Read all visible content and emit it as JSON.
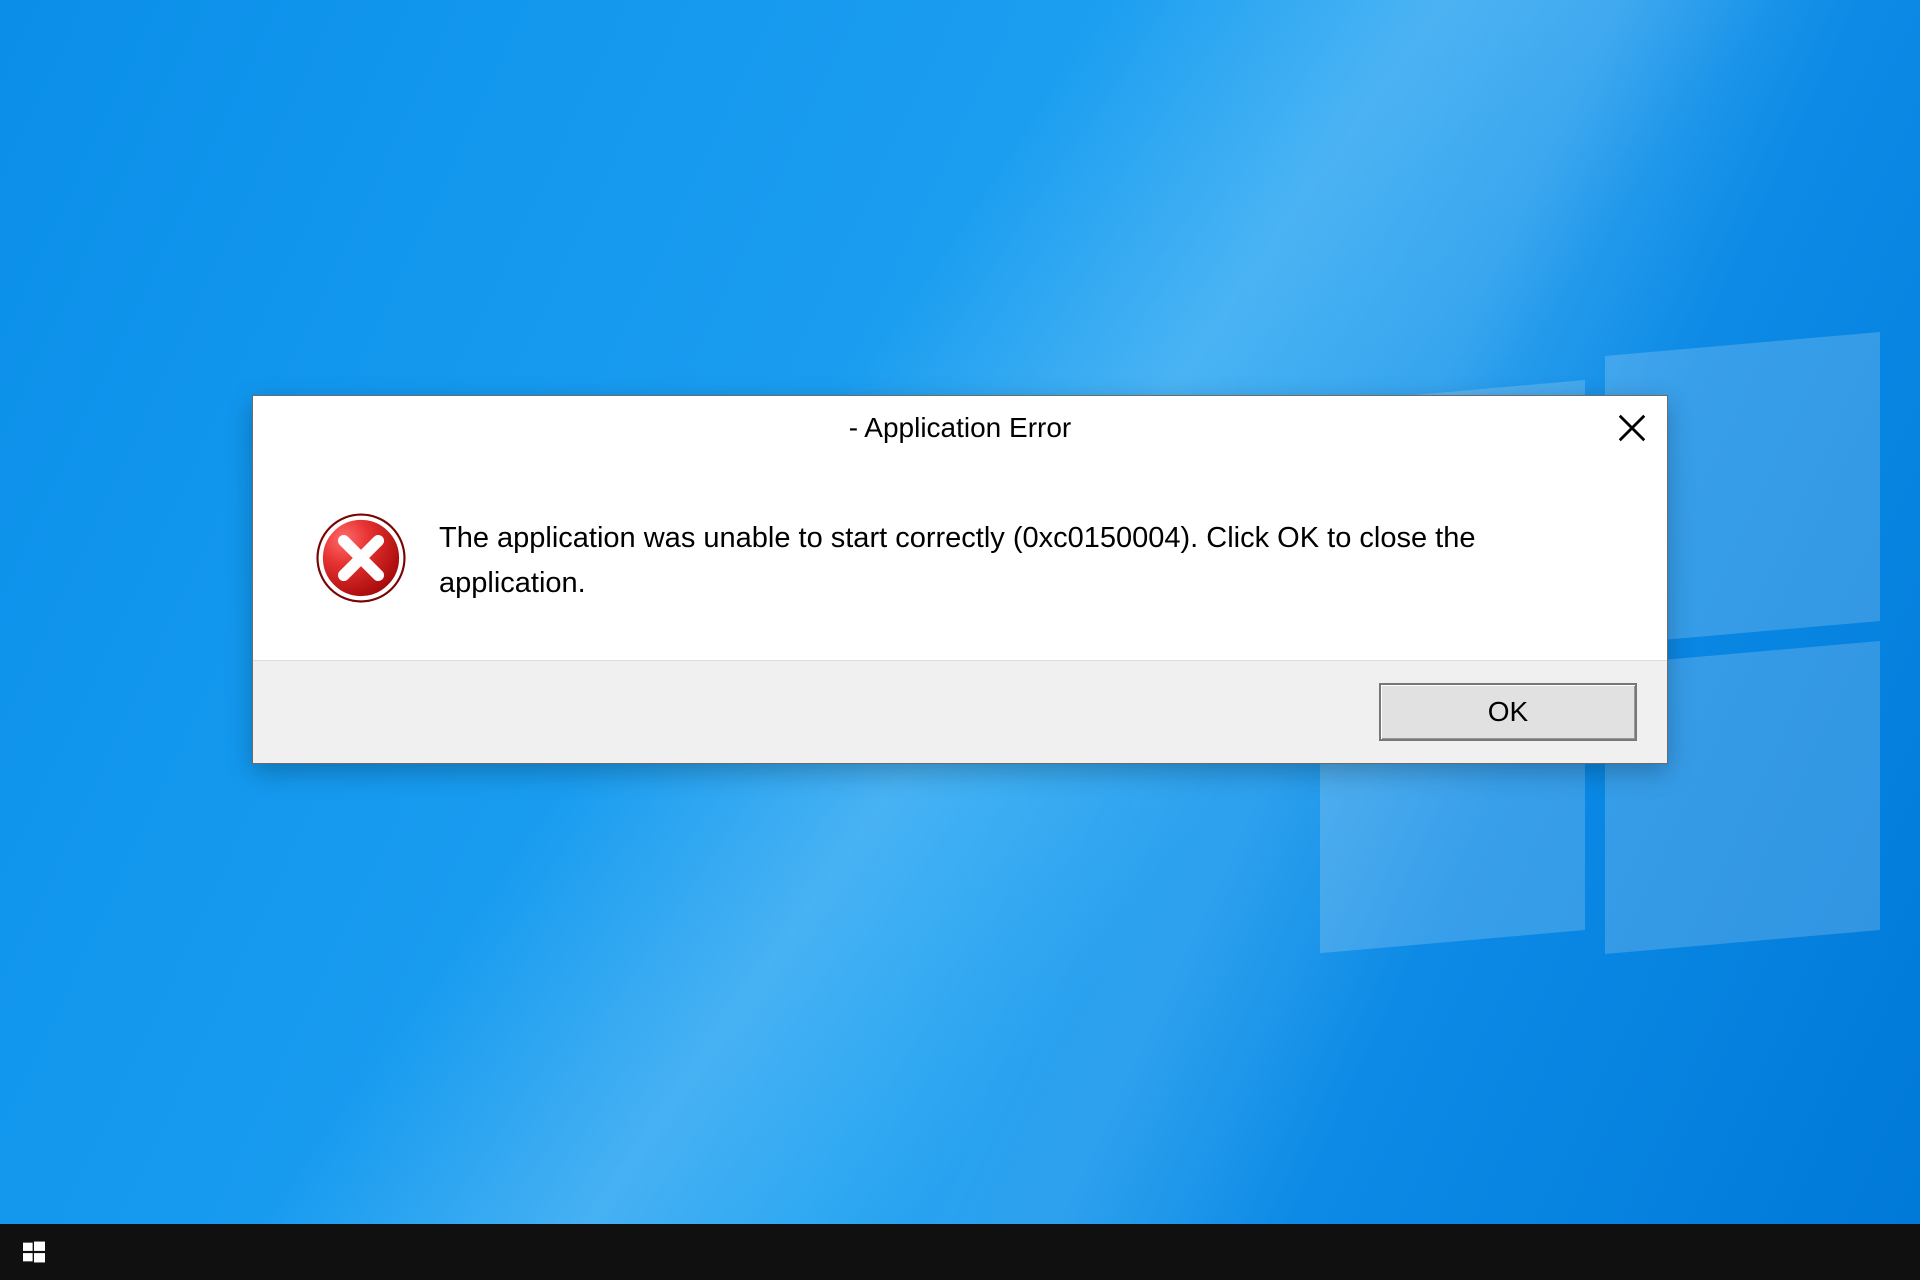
{
  "dialog": {
    "title": "- Application Error",
    "message": "The application was unable to start correctly (0xc0150004). Click OK to close the application.",
    "ok_label": "OK"
  }
}
